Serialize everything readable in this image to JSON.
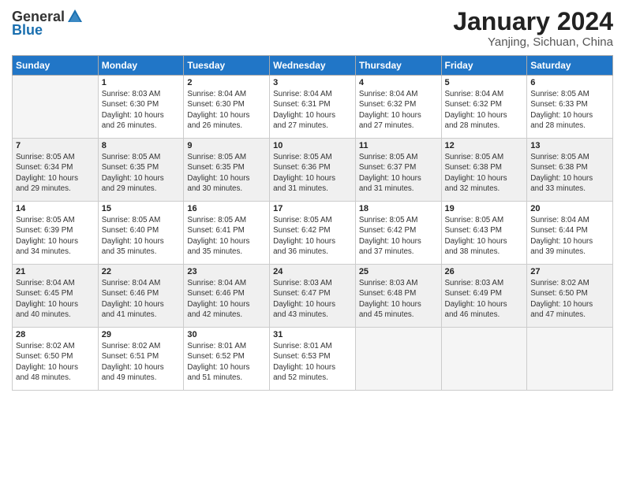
{
  "logo": {
    "general": "General",
    "blue": "Blue"
  },
  "title": "January 2024",
  "location": "Yanjing, Sichuan, China",
  "days_of_week": [
    "Sunday",
    "Monday",
    "Tuesday",
    "Wednesday",
    "Thursday",
    "Friday",
    "Saturday"
  ],
  "weeks": [
    [
      {
        "day": "",
        "info": ""
      },
      {
        "day": "1",
        "info": "Sunrise: 8:03 AM\nSunset: 6:30 PM\nDaylight: 10 hours\nand 26 minutes."
      },
      {
        "day": "2",
        "info": "Sunrise: 8:04 AM\nSunset: 6:30 PM\nDaylight: 10 hours\nand 26 minutes."
      },
      {
        "day": "3",
        "info": "Sunrise: 8:04 AM\nSunset: 6:31 PM\nDaylight: 10 hours\nand 27 minutes."
      },
      {
        "day": "4",
        "info": "Sunrise: 8:04 AM\nSunset: 6:32 PM\nDaylight: 10 hours\nand 27 minutes."
      },
      {
        "day": "5",
        "info": "Sunrise: 8:04 AM\nSunset: 6:32 PM\nDaylight: 10 hours\nand 28 minutes."
      },
      {
        "day": "6",
        "info": "Sunrise: 8:05 AM\nSunset: 6:33 PM\nDaylight: 10 hours\nand 28 minutes."
      }
    ],
    [
      {
        "day": "7",
        "info": "Sunrise: 8:05 AM\nSunset: 6:34 PM\nDaylight: 10 hours\nand 29 minutes."
      },
      {
        "day": "8",
        "info": "Sunrise: 8:05 AM\nSunset: 6:35 PM\nDaylight: 10 hours\nand 29 minutes."
      },
      {
        "day": "9",
        "info": "Sunrise: 8:05 AM\nSunset: 6:35 PM\nDaylight: 10 hours\nand 30 minutes."
      },
      {
        "day": "10",
        "info": "Sunrise: 8:05 AM\nSunset: 6:36 PM\nDaylight: 10 hours\nand 31 minutes."
      },
      {
        "day": "11",
        "info": "Sunrise: 8:05 AM\nSunset: 6:37 PM\nDaylight: 10 hours\nand 31 minutes."
      },
      {
        "day": "12",
        "info": "Sunrise: 8:05 AM\nSunset: 6:38 PM\nDaylight: 10 hours\nand 32 minutes."
      },
      {
        "day": "13",
        "info": "Sunrise: 8:05 AM\nSunset: 6:38 PM\nDaylight: 10 hours\nand 33 minutes."
      }
    ],
    [
      {
        "day": "14",
        "info": "Sunrise: 8:05 AM\nSunset: 6:39 PM\nDaylight: 10 hours\nand 34 minutes."
      },
      {
        "day": "15",
        "info": "Sunrise: 8:05 AM\nSunset: 6:40 PM\nDaylight: 10 hours\nand 35 minutes."
      },
      {
        "day": "16",
        "info": "Sunrise: 8:05 AM\nSunset: 6:41 PM\nDaylight: 10 hours\nand 35 minutes."
      },
      {
        "day": "17",
        "info": "Sunrise: 8:05 AM\nSunset: 6:42 PM\nDaylight: 10 hours\nand 36 minutes."
      },
      {
        "day": "18",
        "info": "Sunrise: 8:05 AM\nSunset: 6:42 PM\nDaylight: 10 hours\nand 37 minutes."
      },
      {
        "day": "19",
        "info": "Sunrise: 8:05 AM\nSunset: 6:43 PM\nDaylight: 10 hours\nand 38 minutes."
      },
      {
        "day": "20",
        "info": "Sunrise: 8:04 AM\nSunset: 6:44 PM\nDaylight: 10 hours\nand 39 minutes."
      }
    ],
    [
      {
        "day": "21",
        "info": "Sunrise: 8:04 AM\nSunset: 6:45 PM\nDaylight: 10 hours\nand 40 minutes."
      },
      {
        "day": "22",
        "info": "Sunrise: 8:04 AM\nSunset: 6:46 PM\nDaylight: 10 hours\nand 41 minutes."
      },
      {
        "day": "23",
        "info": "Sunrise: 8:04 AM\nSunset: 6:46 PM\nDaylight: 10 hours\nand 42 minutes."
      },
      {
        "day": "24",
        "info": "Sunrise: 8:03 AM\nSunset: 6:47 PM\nDaylight: 10 hours\nand 43 minutes."
      },
      {
        "day": "25",
        "info": "Sunrise: 8:03 AM\nSunset: 6:48 PM\nDaylight: 10 hours\nand 45 minutes."
      },
      {
        "day": "26",
        "info": "Sunrise: 8:03 AM\nSunset: 6:49 PM\nDaylight: 10 hours\nand 46 minutes."
      },
      {
        "day": "27",
        "info": "Sunrise: 8:02 AM\nSunset: 6:50 PM\nDaylight: 10 hours\nand 47 minutes."
      }
    ],
    [
      {
        "day": "28",
        "info": "Sunrise: 8:02 AM\nSunset: 6:50 PM\nDaylight: 10 hours\nand 48 minutes."
      },
      {
        "day": "29",
        "info": "Sunrise: 8:02 AM\nSunset: 6:51 PM\nDaylight: 10 hours\nand 49 minutes."
      },
      {
        "day": "30",
        "info": "Sunrise: 8:01 AM\nSunset: 6:52 PM\nDaylight: 10 hours\nand 51 minutes."
      },
      {
        "day": "31",
        "info": "Sunrise: 8:01 AM\nSunset: 6:53 PM\nDaylight: 10 hours\nand 52 minutes."
      },
      {
        "day": "",
        "info": ""
      },
      {
        "day": "",
        "info": ""
      },
      {
        "day": "",
        "info": ""
      }
    ]
  ]
}
